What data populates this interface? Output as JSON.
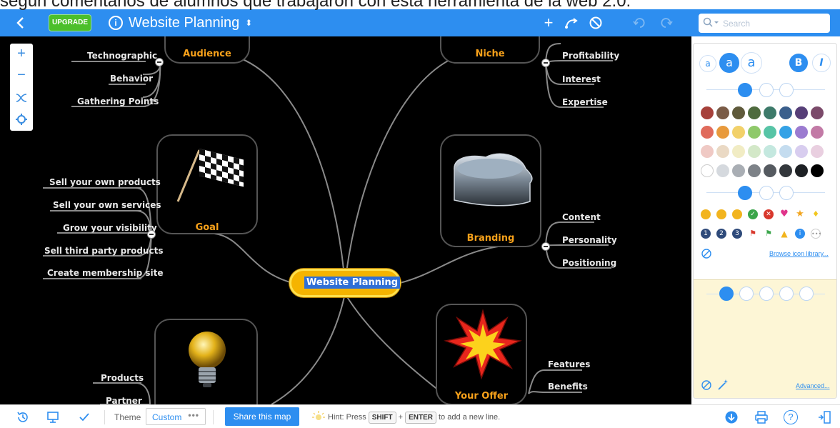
{
  "caption": "según comentarios de alumnos que trabajaron con esta herramienta de la web 2.0:",
  "topbar": {
    "back_icon": "chevron-left-icon",
    "upgrade_label": "UPGRADE",
    "info_glyph": "i",
    "title": "Website Planning",
    "title_toggle_glyph": "⬍",
    "add_glyph": "+",
    "search_placeholder": "Search",
    "search_icon": "search-icon"
  },
  "mindmap": {
    "central": "Website Planning",
    "topics": {
      "audience": "Audience",
      "niche": "Niche",
      "goal": "Goal",
      "branding": "Branding",
      "your_offer": "Your Offer"
    },
    "audience_children": [
      "Technographic",
      "Behavior",
      "Gathering Points"
    ],
    "niche_children": [
      "Profitability",
      "Interest",
      "Expertise"
    ],
    "goal_children": [
      "Sell your own products",
      "Sell your own services",
      "Grow your visibility",
      "Sell third party products",
      "Create membership site"
    ],
    "branding_children": [
      "Content",
      "Personality",
      "Positioning"
    ],
    "offer_children": [
      "Features",
      "Benefits"
    ],
    "idea_children": [
      "Products",
      "Partner"
    ]
  },
  "panel": {
    "font_sizes": [
      "a",
      "a",
      "a"
    ],
    "bold": "B",
    "italic": "I",
    "colors": [
      [
        "#a6403a",
        "#7a5b46",
        "#5f5a3b",
        "#4f6b3e",
        "#3d7a6a",
        "#3a5f8c",
        "#573f78",
        "#7b4a6a"
      ],
      [
        "#e06b5c",
        "#e89a3c",
        "#f2d16a",
        "#8fc96a",
        "#57c4a6",
        "#35a2e6",
        "#9b7bd0",
        "#c27aa6"
      ],
      [
        "#efc9c4",
        "#ead9c4",
        "#f1ecc4",
        "#d3e8c8",
        "#c4e8df",
        "#c4dcef",
        "#d8cdef",
        "#e9cfe0"
      ],
      [
        "#ffffff",
        "#d5d9de",
        "#a9aeb4",
        "#7d8288",
        "#555a60",
        "#33373c",
        "#1d2024",
        "#000000"
      ]
    ],
    "browse_label": "Browse icon library...",
    "advanced_label": "Advanced..."
  },
  "bottombar": {
    "theme_label": "Theme",
    "theme_value": "Custom",
    "theme_more": "•••",
    "share_label": "Share this map",
    "hint_prefix": "Hint:",
    "hint_press": "Press",
    "hint_key1": "SHIFT",
    "hint_plus": "+",
    "hint_key2": "ENTER",
    "hint_suffix": "to add a new line.",
    "help_glyph": "?"
  }
}
